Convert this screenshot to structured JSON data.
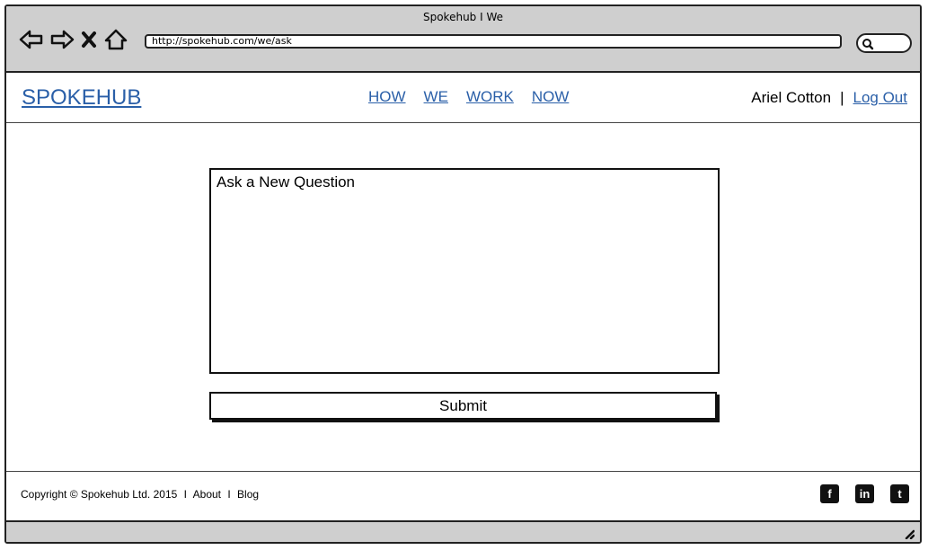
{
  "browser": {
    "window_title": "Spokehub I We",
    "url": "http://spokehub.com/we/ask",
    "nav_icons": [
      "back-arrow-icon",
      "forward-arrow-icon",
      "close-icon",
      "home-icon"
    ],
    "search_icon": "search-icon"
  },
  "header": {
    "logo": "SPOKEHUB",
    "nav": [
      "HOW",
      "WE",
      "WORK",
      "NOW"
    ],
    "user_name": "Ariel Cotton",
    "separator": "|",
    "logout": "Log Out"
  },
  "main": {
    "question_placeholder": "Ask a New Question",
    "submit_label": "Submit"
  },
  "footer": {
    "copyright": "Copyright © Spokehub Ltd. 2015",
    "sep1": "I",
    "about": "About",
    "sep2": "I",
    "blog": "Blog",
    "social": [
      {
        "icon": "facebook-icon",
        "glyph": "f"
      },
      {
        "icon": "linkedin-icon",
        "glyph": "in"
      },
      {
        "icon": "twitter-icon",
        "glyph": "t"
      }
    ]
  },
  "colors": {
    "link": "#2a5fa8",
    "chrome": "#cfcfcf"
  }
}
